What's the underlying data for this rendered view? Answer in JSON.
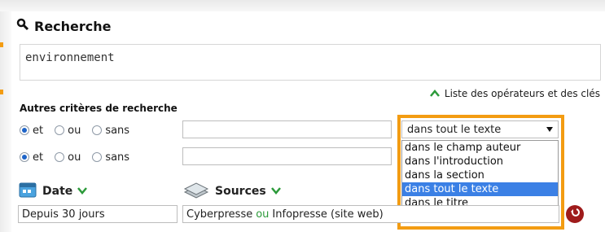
{
  "header": {
    "title": "Recherche"
  },
  "search": {
    "query": "environnement"
  },
  "operators_link": {
    "label": "Liste des opérateurs et des clés"
  },
  "criteria": {
    "title": "Autres critères de recherche",
    "rows": [
      {
        "options": [
          "et",
          "ou",
          "sans"
        ],
        "selected": "et"
      },
      {
        "options": [
          "et",
          "ou",
          "sans"
        ],
        "selected": "et"
      }
    ]
  },
  "scope_select": {
    "selected": "dans tout le texte",
    "options": [
      "dans le champ auteur",
      "dans l'introduction",
      "dans la section",
      "dans tout le texte",
      "dans le titre"
    ]
  },
  "date": {
    "label": "Date",
    "value": "Depuis 30 jours"
  },
  "sources": {
    "label": "Sources",
    "value_part1": "Cyberpresse",
    "value_or": "ou",
    "value_part2": "Infopresse (site web)"
  },
  "colors": {
    "orange_highlight": "#f39c12",
    "green_chevron": "#2c9a3a",
    "selected_option": "#3b80e5",
    "go_button": "#9f1b1b"
  }
}
